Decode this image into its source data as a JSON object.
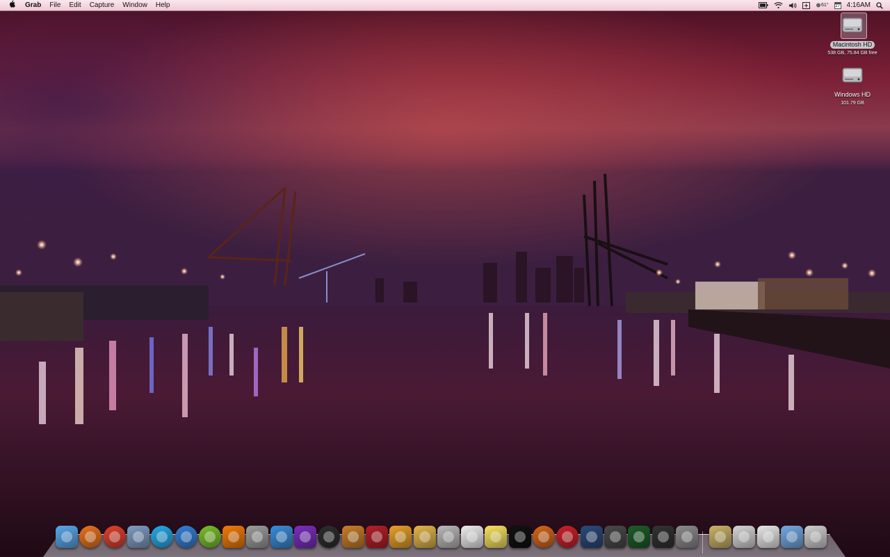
{
  "menubar": {
    "apple_icon": "apple-icon",
    "app_name": "Grab",
    "menus": [
      "File",
      "Edit",
      "Capture",
      "Window",
      "Help"
    ],
    "status": {
      "battery_icon": "battery-icon",
      "wifi_icon": "wifi-icon",
      "volume_icon": "volume-icon",
      "timemachine_icon": "time-machine-icon",
      "temperature": "61°",
      "calendar_day": "27",
      "clock": "4:16AM",
      "search_icon": "spotlight-search-icon"
    }
  },
  "desktop": {
    "drives": [
      {
        "name": "Macintosh HD",
        "info": "538 GB, 75.84 GB free",
        "selected": true
      },
      {
        "name": "Windows HD",
        "info": "101.79 GB",
        "selected": false
      }
    ]
  },
  "dock": {
    "apps": [
      {
        "name": "Finder",
        "icon": "finder-icon",
        "color": "#5aa7e8"
      },
      {
        "name": "Firefox",
        "icon": "firefox-icon",
        "color": "#e8741d"
      },
      {
        "name": "Chrome",
        "icon": "chrome-icon",
        "color": "#e0412f"
      },
      {
        "name": "Preview",
        "icon": "preview-icon",
        "color": "#7f9cc2"
      },
      {
        "name": "Skype",
        "icon": "skype-icon",
        "color": "#27a9e8"
      },
      {
        "name": "iTunes",
        "icon": "itunes-icon",
        "color": "#3580d6"
      },
      {
        "name": "Spotify",
        "icon": "spotify-icon",
        "color": "#7bbf2c"
      },
      {
        "name": "VLC",
        "icon": "vlc-icon",
        "color": "#f07b0c"
      },
      {
        "name": "Installer",
        "icon": "installer-icon",
        "color": "#9d9d9d"
      },
      {
        "name": "Cleaner",
        "icon": "broom-icon",
        "color": "#3a8dd8"
      },
      {
        "name": "Game 3",
        "icon": "game-3-icon",
        "color": "#7a2fbf"
      },
      {
        "name": "Round App",
        "icon": "globe-icon",
        "color": "#2e2e2e"
      },
      {
        "name": "GarageBand",
        "icon": "guitar-icon",
        "color": "#c77e2b"
      },
      {
        "name": "Photo Booth",
        "icon": "photo-booth-icon",
        "color": "#b3202a"
      },
      {
        "name": "iPhoto",
        "icon": "iphoto-icon",
        "color": "#e5a02a"
      },
      {
        "name": "Paintbrush",
        "icon": "paintbrush-icon",
        "color": "#e0b54b"
      },
      {
        "name": "Script Editor",
        "icon": "script-icon",
        "color": "#b9b9b9"
      },
      {
        "name": "TextEdit",
        "icon": "textedit-icon",
        "color": "#ededed"
      },
      {
        "name": "Stickies",
        "icon": "stickies-icon",
        "color": "#f6e260"
      },
      {
        "name": "Batman",
        "icon": "batman-icon",
        "color": "#111111"
      },
      {
        "name": "Game Ball",
        "icon": "game-ball-icon",
        "color": "#d6661a"
      },
      {
        "name": "CMR",
        "icon": "cmr-icon",
        "color": "#c8222b"
      },
      {
        "name": "Racing Game",
        "icon": "racing-icon",
        "color": "#2c4a7a"
      },
      {
        "name": "Tesla",
        "icon": "tesla-icon",
        "color": "#4a4a4a"
      },
      {
        "name": "Activity Monitor",
        "icon": "activity-monitor-icon",
        "color": "#1f5c2a"
      },
      {
        "name": "Piano",
        "icon": "piano-icon",
        "color": "#333333"
      },
      {
        "name": "System Preferences",
        "icon": "gear-icon",
        "color": "#8c8c8c"
      },
      {
        "name": "Archive",
        "icon": "archive-icon",
        "color": "#c9b26a"
      },
      {
        "name": "Activity Monitor Doc",
        "icon": "monitor-doc-icon",
        "color": "#d6d6d6"
      },
      {
        "name": "Document",
        "icon": "document-icon",
        "color": "#e8e8e8"
      },
      {
        "name": "Folder",
        "icon": "folder-icon",
        "color": "#74a9e2"
      },
      {
        "name": "Trash",
        "icon": "trash-icon",
        "color": "#cfcfcf"
      }
    ]
  }
}
